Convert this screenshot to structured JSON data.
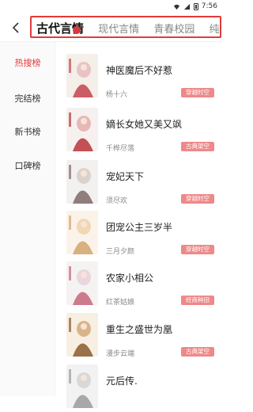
{
  "status": {
    "time": "7:56"
  },
  "tabs": [
    "古代言情",
    "现代言情",
    "青春校园",
    "纯爱"
  ],
  "sidebar": [
    {
      "label": "热搜榜",
      "active": true
    },
    {
      "label": "完结榜",
      "active": false
    },
    {
      "label": "新书榜",
      "active": false
    },
    {
      "label": "口碑榜",
      "active": false
    }
  ],
  "books": [
    {
      "title": "神医魔后不好惹",
      "author": "杨十六",
      "tag": "穿越时空",
      "cover_colors": [
        "#f4efe8",
        "#e9c2c8",
        "#c4434c"
      ]
    },
    {
      "title": "嫡长女她又美又飒",
      "author": "千桦尽落",
      "tag": "古典架空",
      "cover_colors": [
        "#f6f1ef",
        "#e7b8b8",
        "#b8343a"
      ]
    },
    {
      "title": "宠妃天下",
      "author": "须尽欢",
      "tag": "穿越时空",
      "cover_colors": [
        "#f3f1ef",
        "#dcd2cc",
        "#7d6a66"
      ]
    },
    {
      "title": "团宠公主三岁半",
      "author": "三月夕颜",
      "tag": "穿越时空",
      "cover_colors": [
        "#fbf3ea",
        "#f1d7b2",
        "#d2a36c"
      ]
    },
    {
      "title": "农家小相公",
      "author": "红茶姑娘",
      "tag": "经商种田",
      "cover_colors": [
        "#f5f2f2",
        "#e9d6de",
        "#c6667a"
      ]
    },
    {
      "title": "重生之盛世为凰",
      "author": "漫步云端",
      "tag": "古典架空",
      "cover_colors": [
        "#f8efe3",
        "#d9b48a",
        "#8a5a2e"
      ]
    },
    {
      "title": "元后传.",
      "author": "",
      "tag": "",
      "cover_colors": [
        "#f2f2f2",
        "#d8d8d8",
        "#9b9b9b"
      ]
    }
  ]
}
